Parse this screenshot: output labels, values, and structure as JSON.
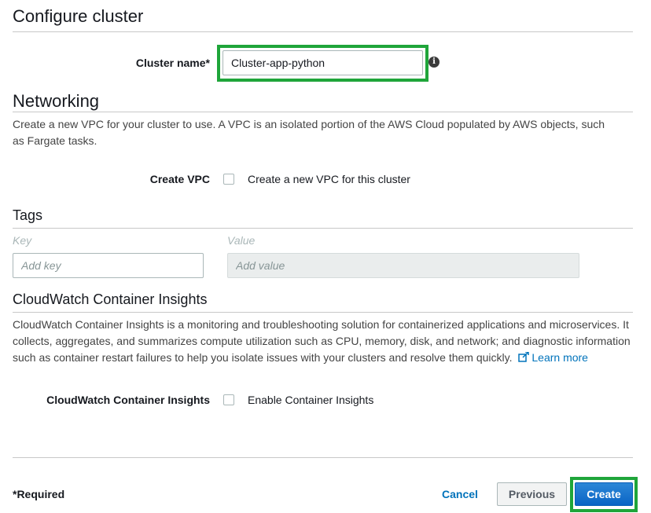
{
  "configure": {
    "title": "Configure cluster",
    "cluster_name_label": "Cluster name*",
    "cluster_name_value": "Cluster-app-python"
  },
  "networking": {
    "title": "Networking",
    "description": "Create a new VPC for your cluster to use. A VPC is an isolated portion of the AWS Cloud populated by AWS objects, such as Fargate tasks.",
    "create_vpc_label": "Create VPC",
    "create_vpc_checkbox_label": "Create a new VPC for this cluster",
    "create_vpc_checked": false
  },
  "tags": {
    "title": "Tags",
    "key_header": "Key",
    "value_header": "Value",
    "key_placeholder": "Add key",
    "value_placeholder": "Add value"
  },
  "cloudwatch": {
    "title": "CloudWatch Container Insights",
    "description": "CloudWatch Container Insights is a monitoring and troubleshooting solution for containerized applications and microservices. It collects, aggregates, and summarizes compute utilization such as CPU, memory, disk, and network; and diagnostic information such as container restart failures to help you isolate issues with your clusters and resolve them quickly.",
    "learn_more": "Learn more",
    "insights_label": "CloudWatch Container Insights",
    "insights_checkbox_label": "Enable Container Insights",
    "insights_checked": false
  },
  "footer": {
    "required_note": "*Required",
    "cancel_label": "Cancel",
    "previous_label": "Previous",
    "create_label": "Create"
  },
  "colors": {
    "highlight": "#1fa53a",
    "primary_button": "#0a64c5",
    "link": "#0073bb"
  },
  "icons": {
    "info": "info-icon",
    "external_link": "external-link-icon"
  }
}
